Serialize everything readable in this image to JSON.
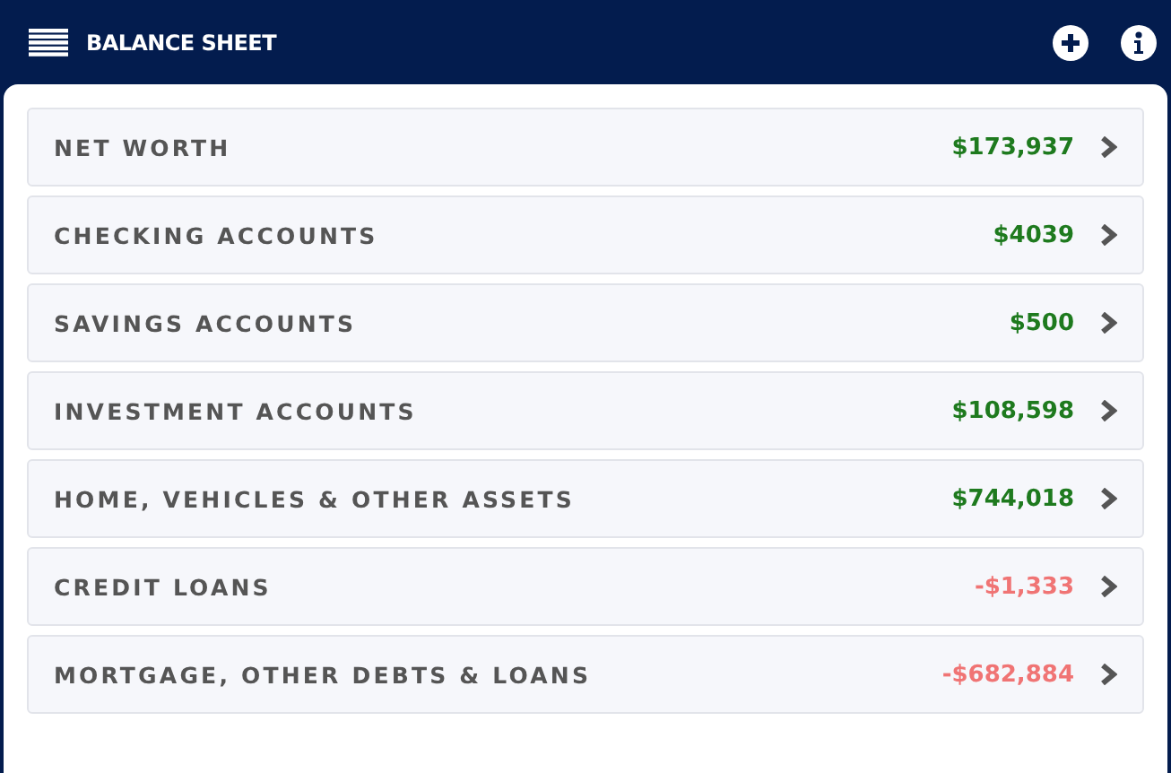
{
  "header": {
    "title": "BALANCE SHEET"
  },
  "rows": [
    {
      "label": "NET WORTH",
      "value": "$173,937",
      "color": "#1e7a1e"
    },
    {
      "label": "CHECKING ACCOUNTS",
      "value": "$4039",
      "color": "#1e7a1e"
    },
    {
      "label": "SAVINGS ACCOUNTS",
      "value": "$500",
      "color": "#1e7a1e"
    },
    {
      "label": "INVESTMENT ACCOUNTS",
      "value": "$108,598",
      "color": "#1e7a1e"
    },
    {
      "label": "HOME, VEHICLES & OTHER ASSETS",
      "value": "$744,018",
      "color": "#1e7a1e"
    },
    {
      "label": "CREDIT LOANS",
      "value": "-$1,333",
      "color": "#f07474"
    },
    {
      "label": "MORTGAGE, OTHER DEBTS & LOANS",
      "value": "-$682,884",
      "color": "#f07474"
    }
  ]
}
